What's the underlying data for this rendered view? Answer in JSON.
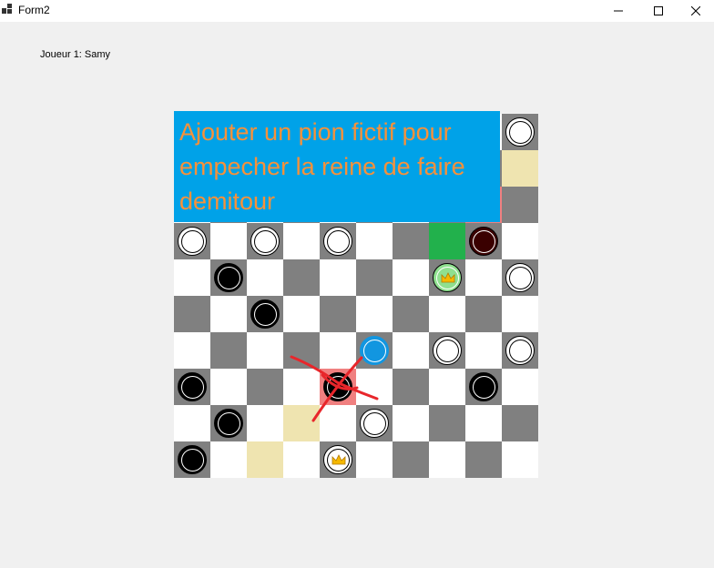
{
  "window": {
    "title": "Form2"
  },
  "player_label": "Joueur 1: Samy",
  "annotation_text": "Ajouter un pion fictif pour empecher la reine de faire demitour",
  "colors": {
    "dark_square": "#808080",
    "light_square": "#ffffff",
    "highlight_tan": "#efe4b0",
    "highlight_red": "#f08080",
    "highlight_green": "#22b14c",
    "annotation_bg": "#00a2e8",
    "annotation_text": "#f7913a",
    "scribble": "#e8262b"
  },
  "board": {
    "size": 10,
    "highlights": [
      {
        "row": 1,
        "col": 9,
        "color": "tan"
      },
      {
        "row": 2,
        "col": 8,
        "color": "red"
      },
      {
        "row": 3,
        "col": 7,
        "color": "green"
      },
      {
        "row": 7,
        "col": 4,
        "color": "red"
      },
      {
        "row": 8,
        "col": 3,
        "color": "tan"
      },
      {
        "row": 9,
        "col": 2,
        "color": "tan"
      }
    ],
    "pieces": [
      {
        "row": 0,
        "col": 9,
        "type": "white"
      },
      {
        "row": 3,
        "col": 0,
        "type": "white"
      },
      {
        "row": 3,
        "col": 2,
        "type": "white"
      },
      {
        "row": 3,
        "col": 4,
        "type": "white"
      },
      {
        "row": 3,
        "col": 8,
        "type": "maroon"
      },
      {
        "row": 4,
        "col": 1,
        "type": "black"
      },
      {
        "row": 4,
        "col": 7,
        "type": "green",
        "king": true
      },
      {
        "row": 4,
        "col": 9,
        "type": "white"
      },
      {
        "row": 5,
        "col": 2,
        "type": "black"
      },
      {
        "row": 6,
        "col": 5,
        "type": "blue"
      },
      {
        "row": 6,
        "col": 7,
        "type": "white"
      },
      {
        "row": 6,
        "col": 9,
        "type": "white"
      },
      {
        "row": 7,
        "col": 0,
        "type": "black"
      },
      {
        "row": 7,
        "col": 4,
        "type": "black"
      },
      {
        "row": 7,
        "col": 8,
        "type": "black"
      },
      {
        "row": 8,
        "col": 1,
        "type": "black"
      },
      {
        "row": 8,
        "col": 5,
        "type": "white"
      },
      {
        "row": 9,
        "col": 0,
        "type": "black"
      },
      {
        "row": 9,
        "col": 4,
        "type": "white",
        "king": true
      }
    ]
  }
}
